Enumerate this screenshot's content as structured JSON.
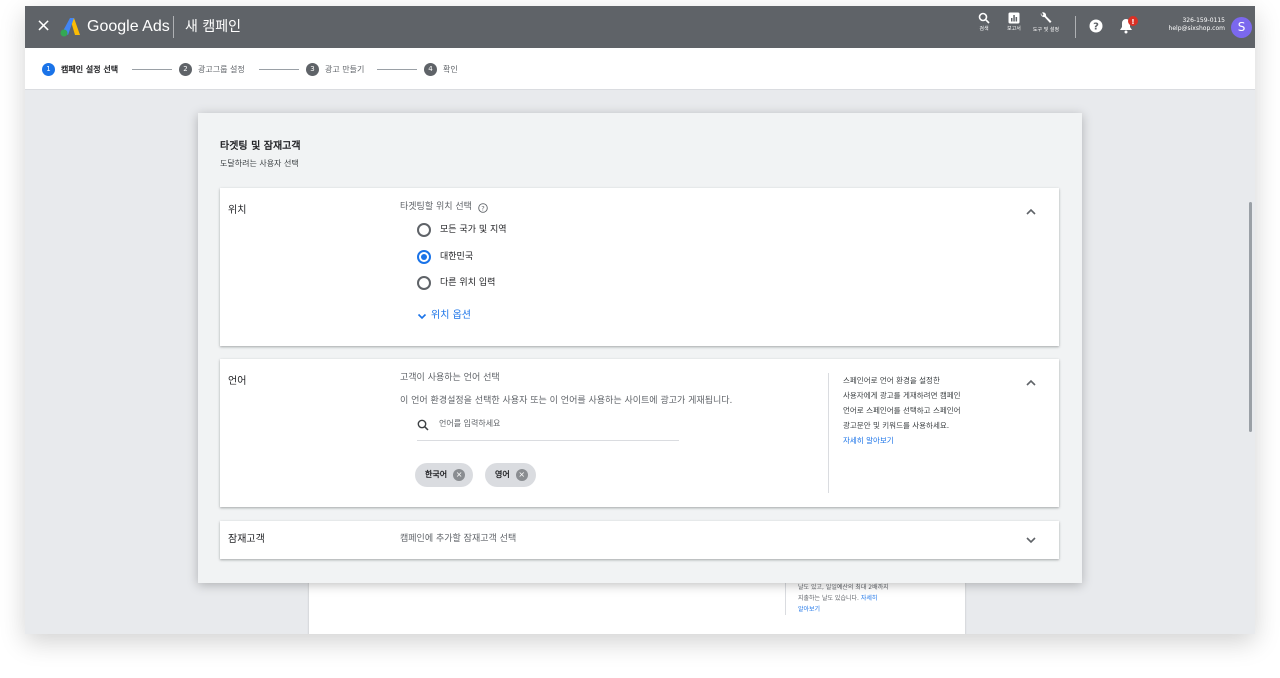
{
  "app": {
    "brand": "Google Ads",
    "page_title": "새 캠페인",
    "close_label": "×"
  },
  "toolbar": {
    "search_label": "검색",
    "reports_label": "보고서",
    "tools_label": "도구 및 설정"
  },
  "account": {
    "customer_id": "326-159-0115",
    "email": "help@sixshop.com",
    "avatar_initial": "S",
    "notification_badge": "!"
  },
  "steps": [
    {
      "num": "1",
      "label": "캠페인 설정 선택",
      "active": true
    },
    {
      "num": "2",
      "label": "광고그룹 설정",
      "active": false
    },
    {
      "num": "3",
      "label": "광고 만들기",
      "active": false
    },
    {
      "num": "4",
      "label": "확인",
      "active": false
    }
  ],
  "panel": {
    "title": "타겟팅 및 잠재고객",
    "subtitle": "도달하려는 사용자 선택"
  },
  "location": {
    "label": "위치",
    "prompt": "타겟팅할 위치 선택",
    "options": [
      {
        "label": "모든 국가 및 지역",
        "checked": false
      },
      {
        "label": "대한민국",
        "checked": true
      },
      {
        "label": "다른 위치 입력",
        "checked": false
      }
    ],
    "options_link": "위치 옵션"
  },
  "language": {
    "label": "언어",
    "prompt": "고객이 사용하는 언어 선택",
    "description": "이 언어 환경설정을 선택한 사용자 또는 이 언어를 사용하는 사이트에 광고가 게재됩니다.",
    "search_placeholder": "언어를 입력하세요",
    "chips": [
      "한국어",
      "영어"
    ],
    "side_note": [
      "스페인어로 언어 환경을 설정한",
      "사용자에게 광고를 게재하려면 캠페인",
      "언어로 스페인어를 선택하고 스페인어",
      "광고문안 및 키워드를 사용하세요."
    ],
    "side_link": "자세히 알아보기"
  },
  "audience": {
    "label": "잠재고객",
    "prompt": "캠페인에 추가할 잠재고객 선택"
  },
  "background_card": {
    "lines": [
      "날도 있고, 일일예산의 최대 2배까지",
      "지출하는 날도 있습니다."
    ],
    "link_part1": "자세히",
    "link_part2": "알아보기"
  },
  "colors": {
    "topbar": "#5f6368",
    "accent": "#1a73e8",
    "background": "#e8eaed"
  }
}
